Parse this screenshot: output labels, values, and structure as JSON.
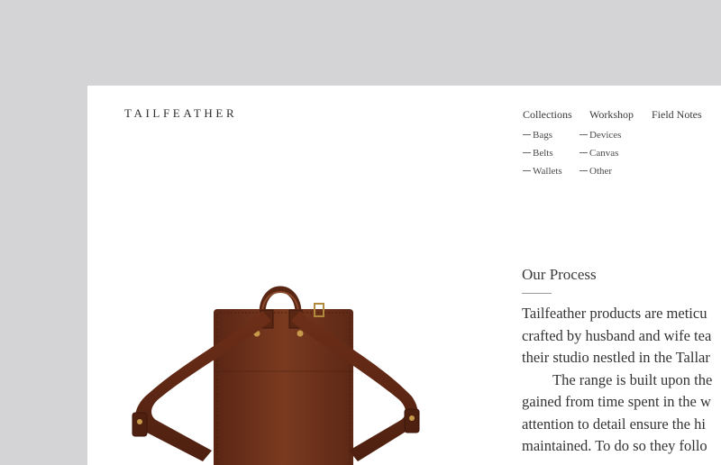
{
  "brand": {
    "logo_text": "TAILFEATHER"
  },
  "nav": {
    "items": [
      {
        "label": "Collections"
      },
      {
        "label": "Workshop"
      },
      {
        "label": "Field Notes"
      }
    ],
    "collections_sub": [
      "Bags",
      "Belts",
      "Wallets"
    ],
    "workshop_sub": [
      "Devices",
      "Canvas",
      "Other"
    ]
  },
  "process": {
    "title": "Our Process",
    "lines": [
      "Tailfeather products are meticu",
      "crafted by husband and wife tea",
      "their studio nestled in the Tallar",
      "The range is built upon the",
      "gained from time spent in the w",
      "attention to detail ensure the hi",
      "maintained. To do so they follo"
    ]
  },
  "product_image": {
    "alt": "backpack-image",
    "color": "#6b2f1a"
  }
}
